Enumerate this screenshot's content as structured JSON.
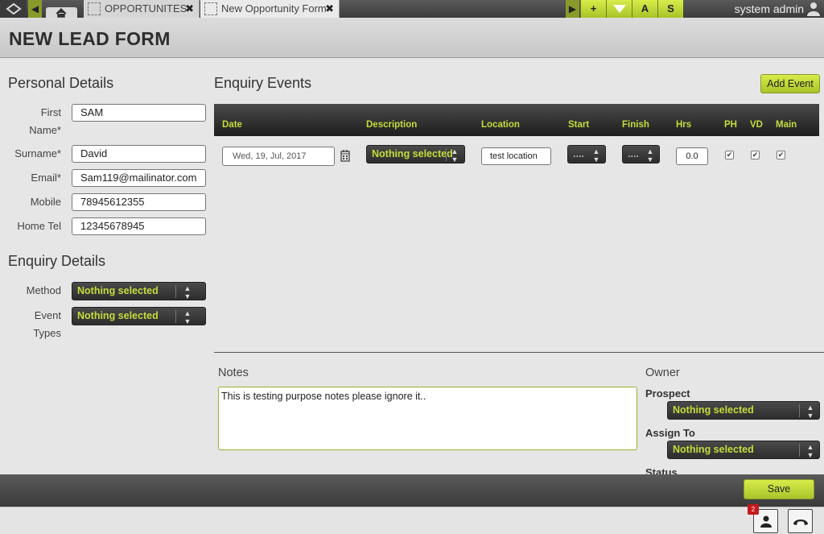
{
  "topbar": {
    "tabs": [
      {
        "label": "OPPORTUNITES",
        "close": "✖"
      },
      {
        "label": "New Opportunity Form",
        "close": "✖"
      }
    ],
    "quick_buttons": [
      "+",
      "",
      "A",
      "S"
    ],
    "user_name": "system admin"
  },
  "page_title": "NEW LEAD FORM",
  "personal": {
    "title": "Personal Details",
    "fields": [
      {
        "label": "First Name*",
        "value": "SAM"
      },
      {
        "label": "Surname*",
        "value": "David"
      },
      {
        "label": "Email*",
        "value": "Sam119@mailinator.com"
      },
      {
        "label": "Mobile",
        "value": "78945612355"
      },
      {
        "label": "Home Tel",
        "value": "12345678945"
      }
    ]
  },
  "enquiry_details": {
    "title": "Enquiry Details",
    "method_label": "Method",
    "method_value": "Nothing selected",
    "event_types_label": "Event Types",
    "event_types_value": "Nothing selected"
  },
  "events": {
    "title": "Enquiry Events",
    "add_button": "Add Event",
    "columns": [
      "Date",
      "Description",
      "Location",
      "Start",
      "Finish",
      "Hrs",
      "PH",
      "VD",
      "Main"
    ],
    "row": {
      "date": "Wed, 19, Jul, 2017",
      "description": "Nothing selected",
      "location": "test location",
      "start": "....",
      "finish": "....",
      "hrs": "0.0",
      "ph": true,
      "vd": true,
      "main": true
    }
  },
  "notes": {
    "label": "Notes",
    "value": "This is testing purpose notes please ignore it.."
  },
  "owner": {
    "title": "Owner",
    "prospect_label": "Prospect",
    "prospect_value": "Nothing selected",
    "assign_label": "Assign To",
    "assign_value": "Nothing selected",
    "status_label": "Status"
  },
  "footer": {
    "save_label": "Save",
    "notification_count": "2"
  },
  "colors": {
    "accent": "#c5dc3a",
    "dark": "#2d2d2d",
    "button": "#b5d12e"
  }
}
